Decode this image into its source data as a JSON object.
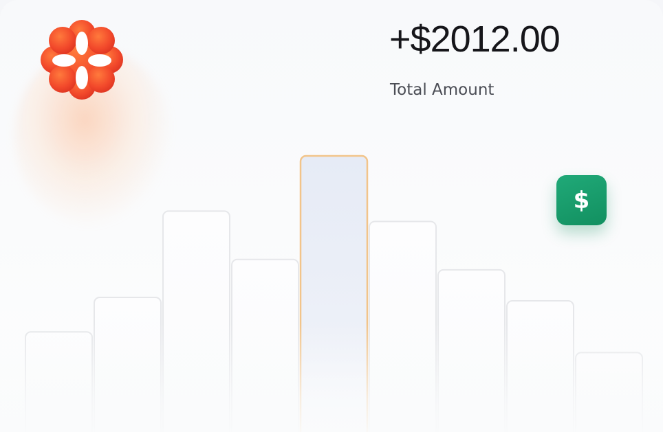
{
  "header": {
    "amount": "+$2012.00",
    "amount_label": "Total Amount"
  },
  "icons": {
    "logo": "flower-logo-icon",
    "badge": "dollar-icon"
  },
  "badge": {
    "symbol": "$"
  },
  "colors": {
    "logo": "#f04a2a",
    "badge": "#179a68",
    "highlight_bar": "#e8edf7",
    "highlight_border": "#f2c48a",
    "bar_border": "#e6e7ea"
  },
  "chart_data": {
    "type": "bar",
    "values": [
      29,
      39,
      64,
      50,
      80,
      61,
      47,
      38,
      23
    ],
    "highlight_index": 4,
    "title": "",
    "xlabel": "",
    "ylabel": ""
  }
}
